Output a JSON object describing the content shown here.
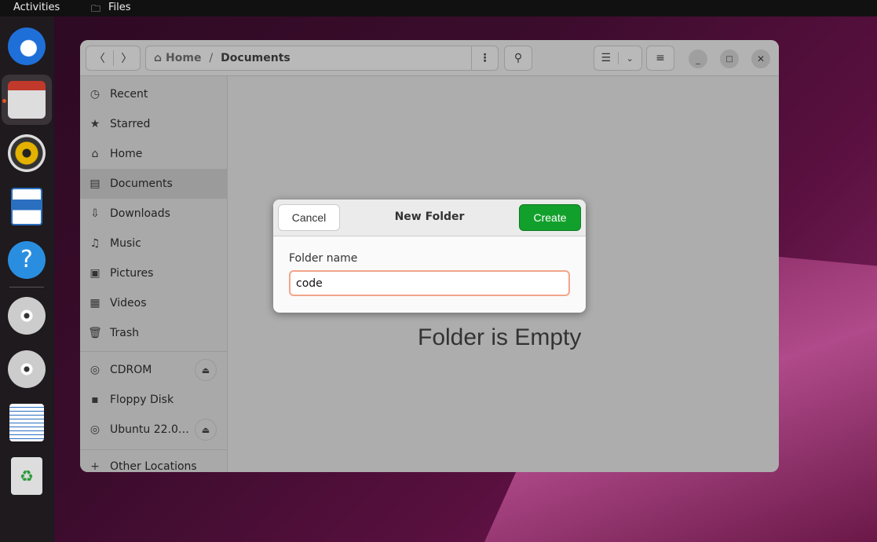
{
  "topbar": {
    "activities": "Activities",
    "app": "Files"
  },
  "dock": [
    "Thunderbird",
    "Files",
    "Rhythmbox",
    "LibreOffice Writer",
    "Help",
    "CD drive",
    "CD drive",
    "Floppy",
    "Trash"
  ],
  "header": {
    "path": [
      {
        "label": "Home"
      },
      {
        "label": "Documents"
      }
    ],
    "separator": "/"
  },
  "sidebar": {
    "items": [
      {
        "label": "Recent",
        "icon": "clock-icon"
      },
      {
        "label": "Starred",
        "icon": "star-icon"
      },
      {
        "label": "Home",
        "icon": "home-icon"
      },
      {
        "label": "Documents",
        "icon": "document-icon",
        "active": true
      },
      {
        "label": "Downloads",
        "icon": "download-icon"
      },
      {
        "label": "Music",
        "icon": "music-icon"
      },
      {
        "label": "Pictures",
        "icon": "picture-icon"
      },
      {
        "label": "Videos",
        "icon": "video-icon"
      },
      {
        "label": "Trash",
        "icon": "trash-icon"
      }
    ],
    "devices": [
      {
        "label": "CDROM",
        "eject": true
      },
      {
        "label": "Floppy Disk",
        "eject": false
      },
      {
        "label": "Ubuntu 22.0…",
        "eject": true
      }
    ],
    "other": "Other Locations"
  },
  "main": {
    "empty_text": "Folder is Empty"
  },
  "dialog": {
    "title": "New Folder",
    "cancel": "Cancel",
    "create": "Create",
    "field_label": "Folder name",
    "field_value": "code"
  },
  "colors": {
    "create": "#12a02c",
    "input_focus": "#f2a58a"
  }
}
